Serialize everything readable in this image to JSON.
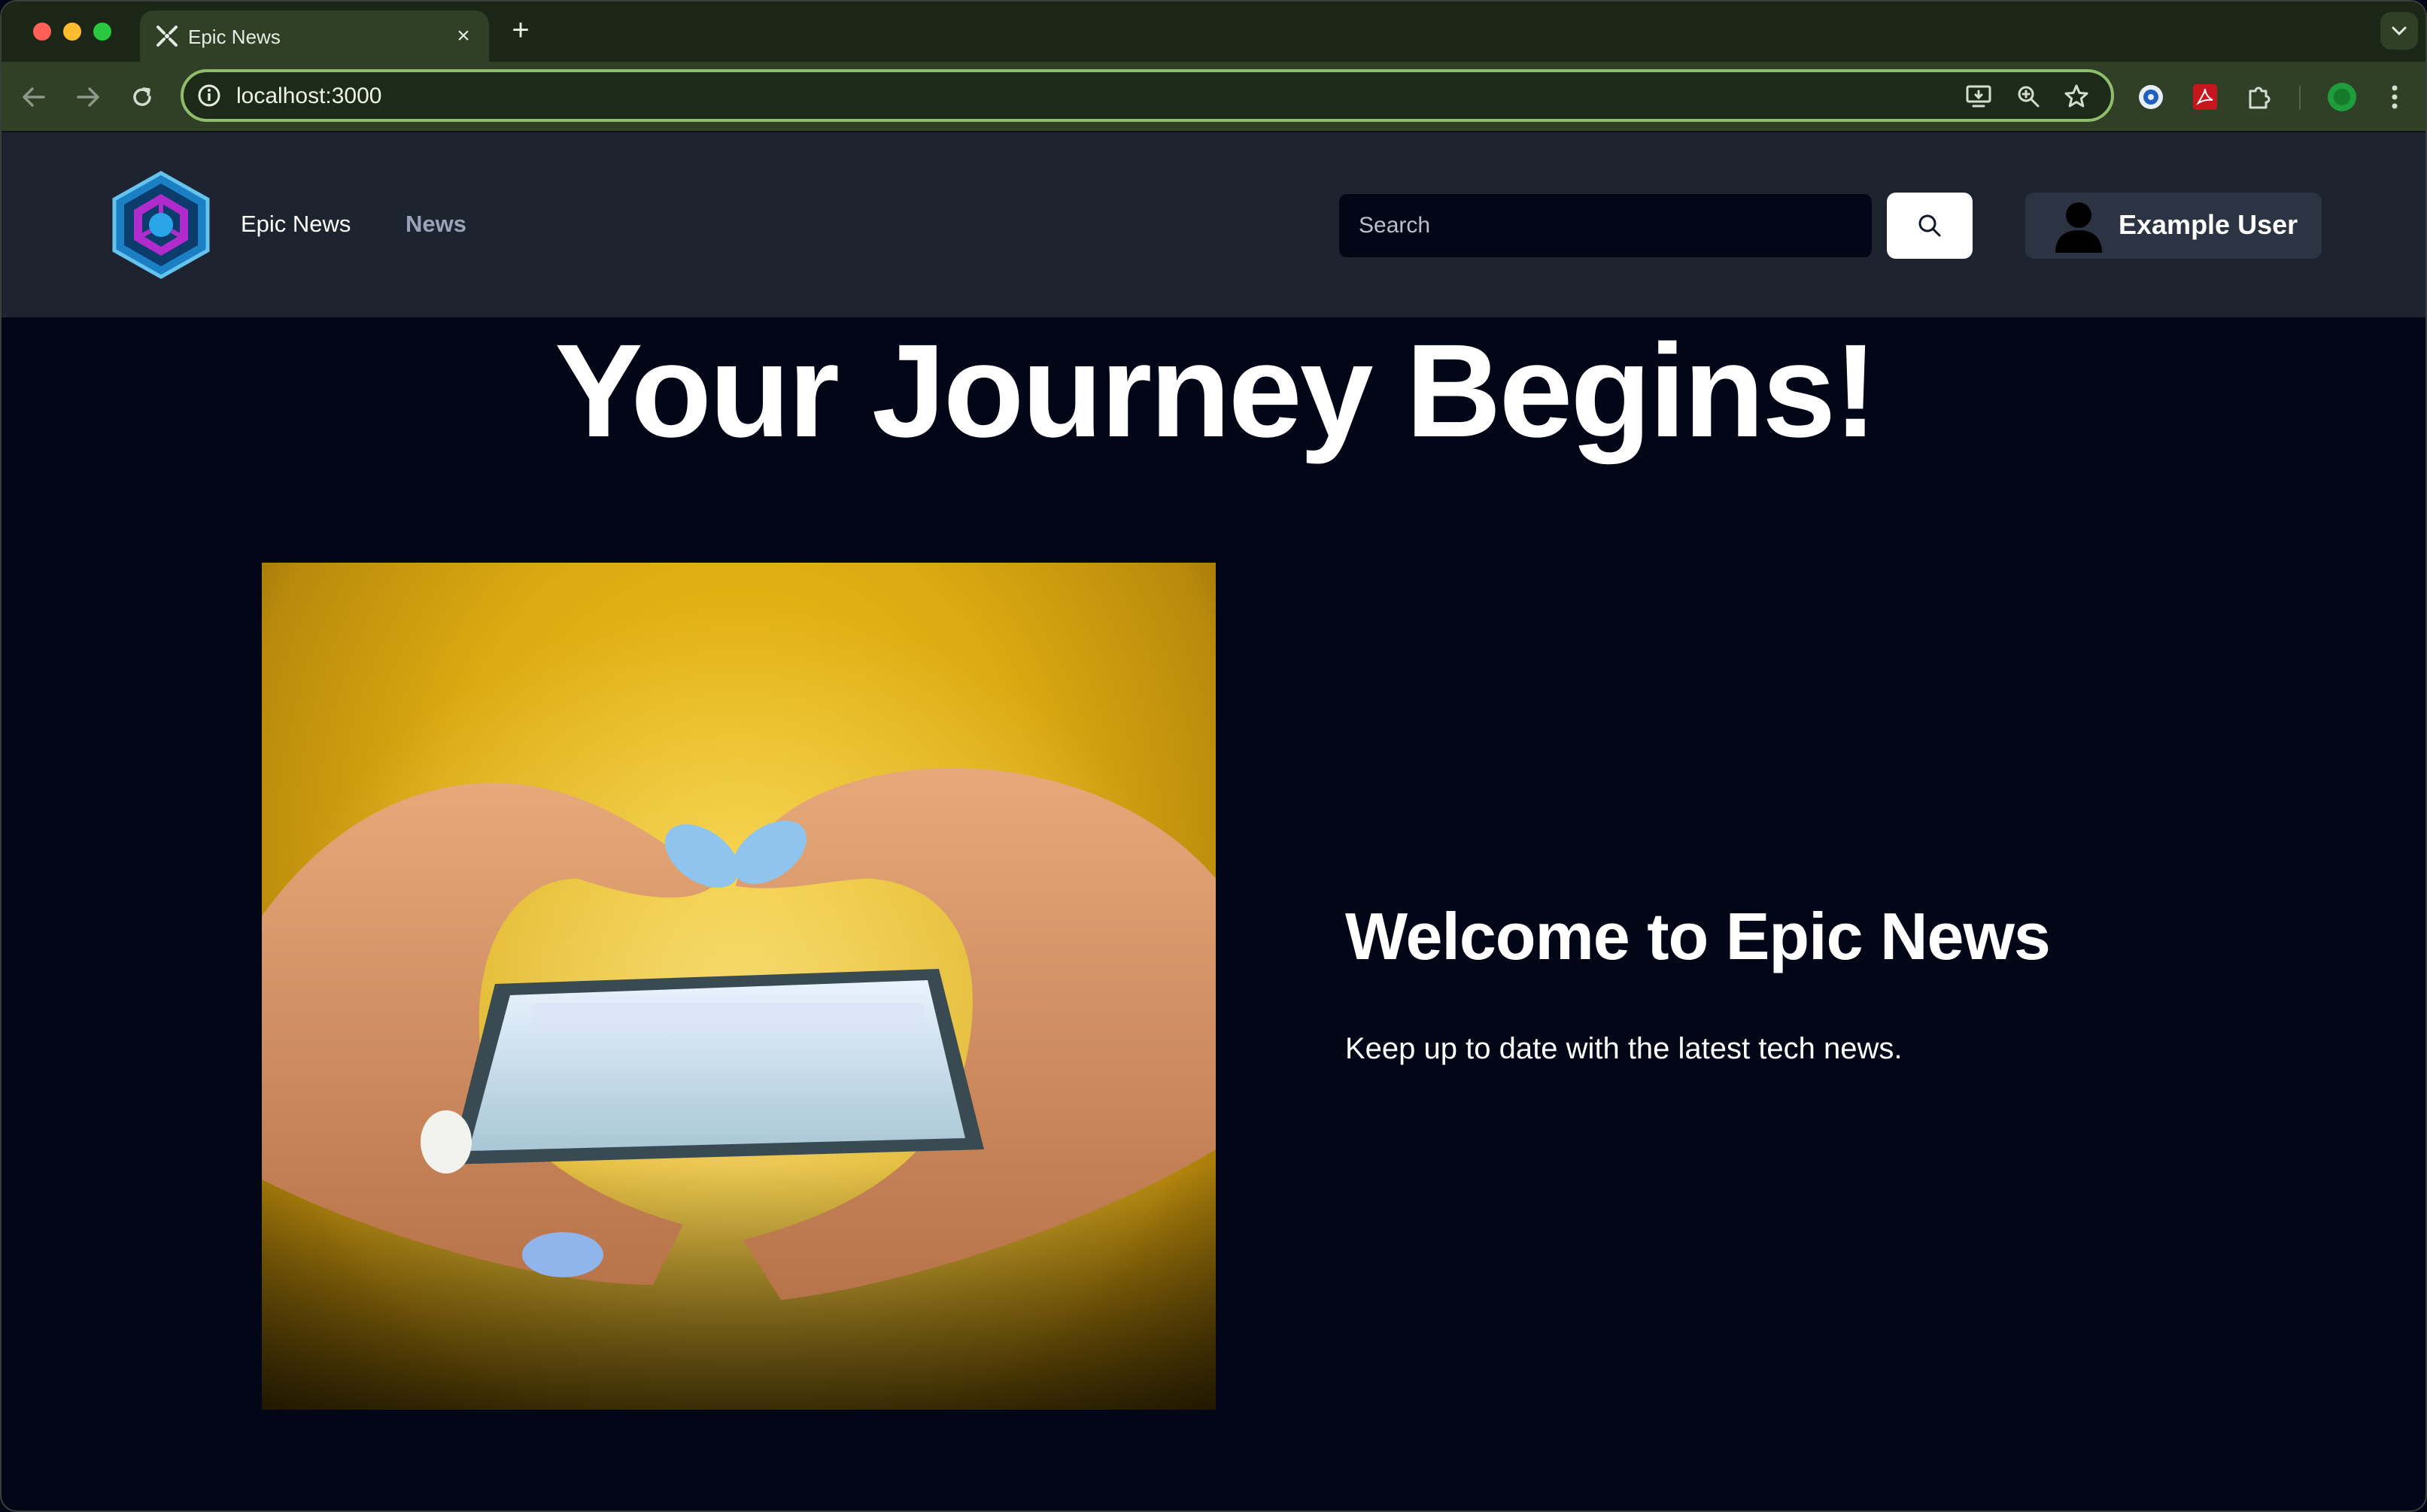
{
  "browser": {
    "tab_title": "Epic News",
    "url": "localhost:3000"
  },
  "site": {
    "brand": "Epic News",
    "nav_news": "News",
    "search_placeholder": "Search",
    "user_name": "Example User"
  },
  "hero": {
    "title": "Your Journey Begins!",
    "image_alt": "hands holding a smartphone"
  },
  "welcome": {
    "title": "Welcome to Epic News",
    "subtitle": "Keep up to date with the latest tech news."
  },
  "colors": {
    "page_bg": "#020617",
    "header_bg": "#1e2330",
    "browser_frame": "#2f4027",
    "image_yellow": "#e2b413"
  }
}
